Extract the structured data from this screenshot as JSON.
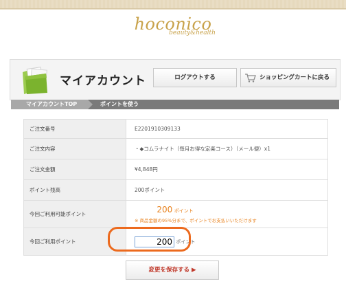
{
  "logo": {
    "main": "hoconico",
    "sub": "beauty&health"
  },
  "header": {
    "title": "マイアカウント",
    "logout_label": "ログアウトする",
    "cart_label": "ショッピングカートに戻る"
  },
  "breadcrumb": [
    "マイアカウントTOP",
    "ポイントを使う"
  ],
  "order": {
    "number_label": "ご注文番号",
    "number_value": "E2201910309133",
    "content_label": "ご注文内容",
    "content_value": "・◆コムラナイト（毎月お得な定楽コース）（メール便）x1",
    "amount_label": "ご注文金額",
    "amount_value": "¥4,848円",
    "points_balance_label": "ポイント残高",
    "points_balance_value": "200ポイント",
    "available_label": "今回ご利用可能ポイント",
    "available_value": "200",
    "available_unit": "ポイント",
    "available_note": "※ 商品金額の95%分まで、ポイントでお支払いいただけます",
    "use_label": "今回ご利用ポイント",
    "use_value": "200",
    "use_unit": "ポイント"
  },
  "save_label": "変更を保存する ▶",
  "colors": {
    "accent": "#e8821e",
    "highlight_ring": "#ec6a1e",
    "logo": "#c8a24a",
    "folder_green": "#7bb32e"
  },
  "icons": {
    "folder": "folder-icon",
    "cart": "shopping-cart-icon"
  }
}
